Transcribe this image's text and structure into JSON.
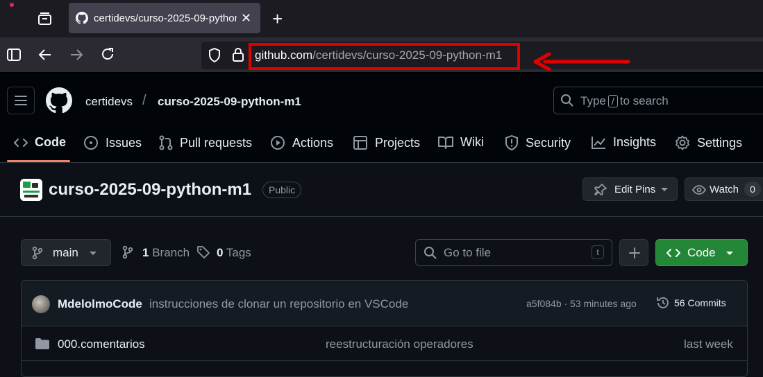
{
  "browser": {
    "tab_title": "certidevs/curso-2025-09-python-m1",
    "url_host": "github.com",
    "url_path": "/certidevs/curso-2025-09-python-m1",
    "highlight_color": "#e00000"
  },
  "header": {
    "owner": "certidevs",
    "separator": "/",
    "repo": "curso-2025-09-python-m1",
    "search_prefix": "Type",
    "search_key": "/",
    "search_suffix": "to search"
  },
  "nav": {
    "tabs": [
      {
        "label": "Code",
        "icon": "code-icon",
        "active": true
      },
      {
        "label": "Issues",
        "icon": "issue-icon"
      },
      {
        "label": "Pull requests",
        "icon": "pull-request-icon"
      },
      {
        "label": "Actions",
        "icon": "play-icon"
      },
      {
        "label": "Projects",
        "icon": "table-icon"
      },
      {
        "label": "Wiki",
        "icon": "book-icon"
      },
      {
        "label": "Security",
        "icon": "shield-icon"
      },
      {
        "label": "Insights",
        "icon": "graph-icon"
      },
      {
        "label": "Settings",
        "icon": "gear-icon"
      }
    ],
    "accent": "#f78166"
  },
  "repo": {
    "title": "curso-2025-09-python-m1",
    "visibility": "Public",
    "edit_pins": "Edit Pins",
    "watch": "Watch",
    "watch_count": "0"
  },
  "files": {
    "branch": "main",
    "branch_count": "1",
    "branch_label": "Branch",
    "tag_count": "0",
    "tag_label": "Tags",
    "goto_placeholder": "Go to file",
    "goto_key": "t",
    "code_button": "Code",
    "code_button_color": "#238636"
  },
  "commit": {
    "author": "MdelolmoCode",
    "message": "instrucciones de clonar un repositorio en VSCode",
    "hash_time": "a5f084b · 53 minutes ago",
    "commits_label": "56 Commits"
  },
  "rows": [
    {
      "name": "000.comentarios",
      "message": "reestructuración operadores",
      "age": "last week"
    }
  ]
}
